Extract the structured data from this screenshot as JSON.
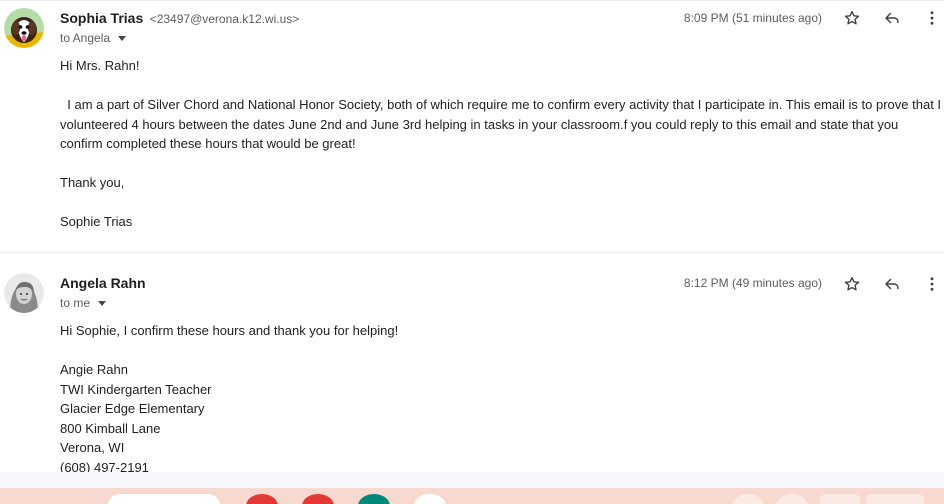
{
  "messages": [
    {
      "sender_name": "Sophia Trias",
      "sender_email": "<23497@verona.k12.wi.us>",
      "to_label": "to Angela",
      "timestamp": "8:09 PM (51 minutes ago)",
      "body": [
        "Hi Mrs. Rahn!",
        "",
        "  I am a part of Silver Chord and National Honor Society, both of which require me to confirm every activity that I participate in. This email is to prove that I volunteered 4 hours between the dates June 2nd and June 3rd helping in tasks in your classroom.f you could reply to this email and state that you confirm completed these hours that would be great!",
        "",
        "Thank you,",
        "",
        "Sophie Trias"
      ]
    },
    {
      "sender_name": "Angela Rahn",
      "to_label": "to me",
      "timestamp": "8:12 PM (49 minutes ago)",
      "body": [
        "Hi Sophie, I confirm these hours and thank you for helping!",
        "",
        "Angie Rahn",
        "TWI Kindergarten Teacher",
        "Glacier Edge Elementary",
        "800 Kimball Lane",
        "Verona, WI",
        "(608) 497-2191"
      ]
    }
  ],
  "icons": {
    "star": "star-icon",
    "reply": "reply-icon",
    "more": "more-vert-icon",
    "caret": "chevron-down-icon"
  },
  "colors": {
    "divider": "#e8eaed",
    "bottom_bar": "#f7d9cf"
  }
}
